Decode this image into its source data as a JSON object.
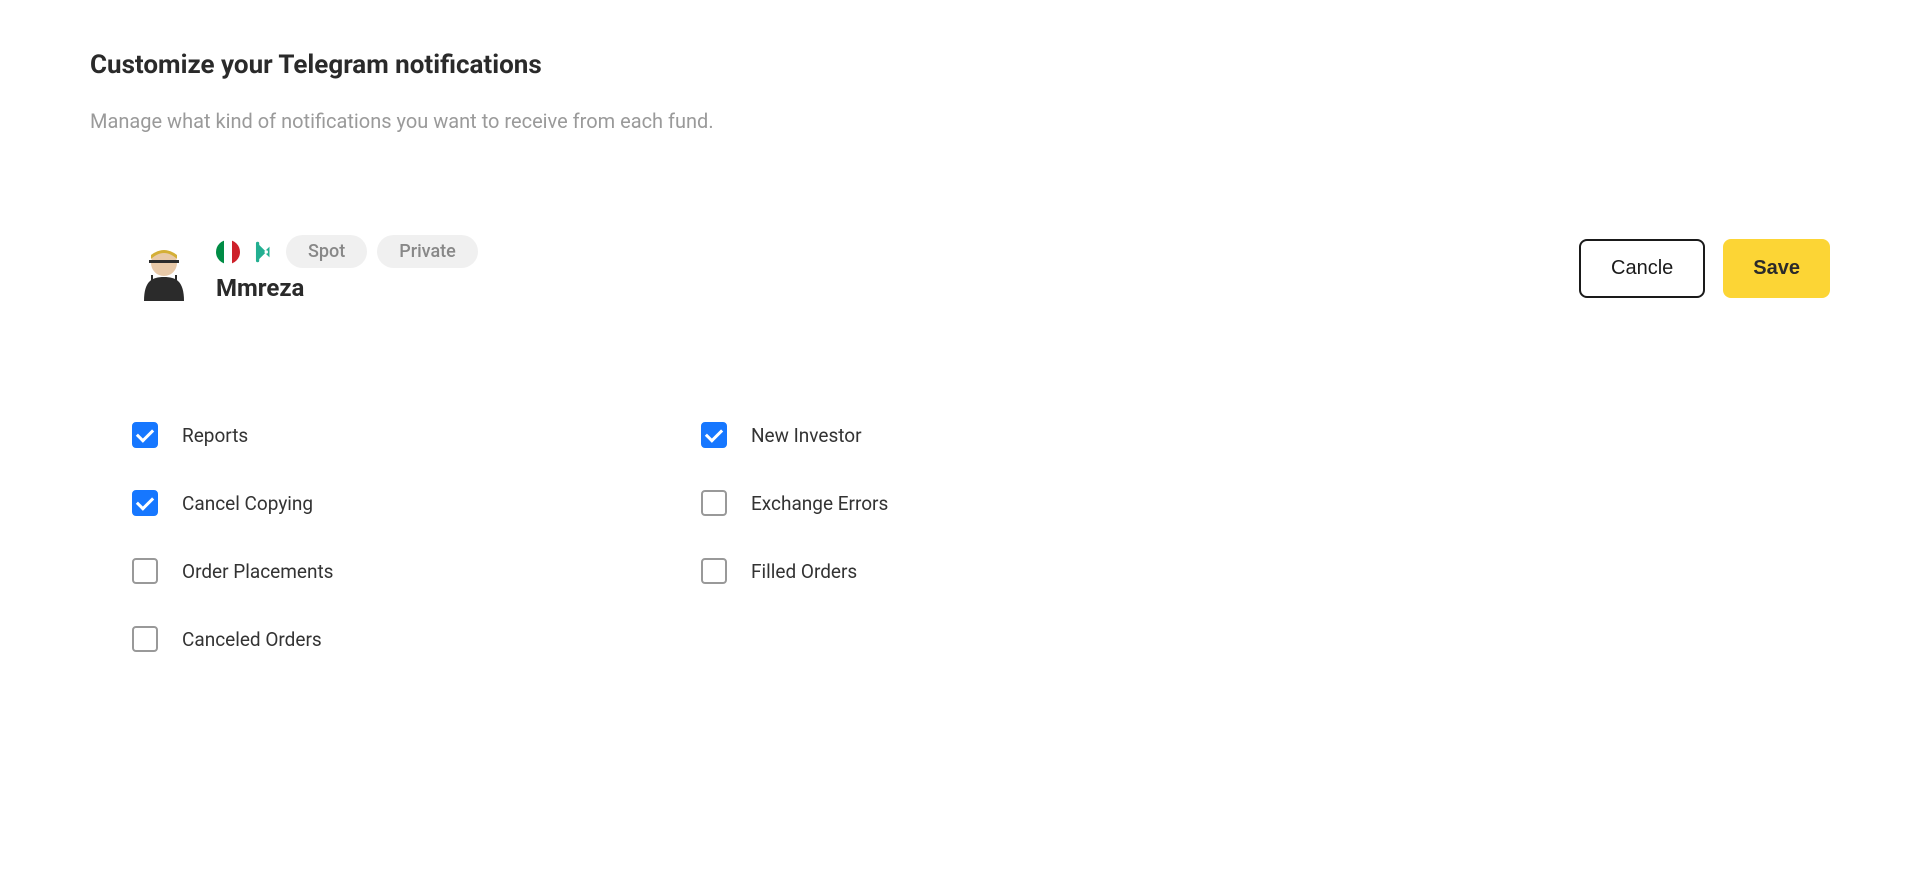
{
  "title": "Customize your Telegram notifications",
  "subtitle": "Manage what kind of notifications you want to receive from each fund.",
  "fund": {
    "name": "Mmreza",
    "pills": {
      "spot": "Spot",
      "private": "Private"
    }
  },
  "actions": {
    "cancel": "Cancle",
    "save": "Save"
  },
  "options": {
    "col1": [
      {
        "label": "Reports",
        "checked": true
      },
      {
        "label": "Cancel Copying",
        "checked": true
      },
      {
        "label": "Order Placements",
        "checked": false
      },
      {
        "label": "Canceled Orders",
        "checked": false
      }
    ],
    "col2": [
      {
        "label": "New Investor",
        "checked": true
      },
      {
        "label": "Exchange Errors",
        "checked": false
      },
      {
        "label": "Filled Orders",
        "checked": false
      }
    ]
  }
}
